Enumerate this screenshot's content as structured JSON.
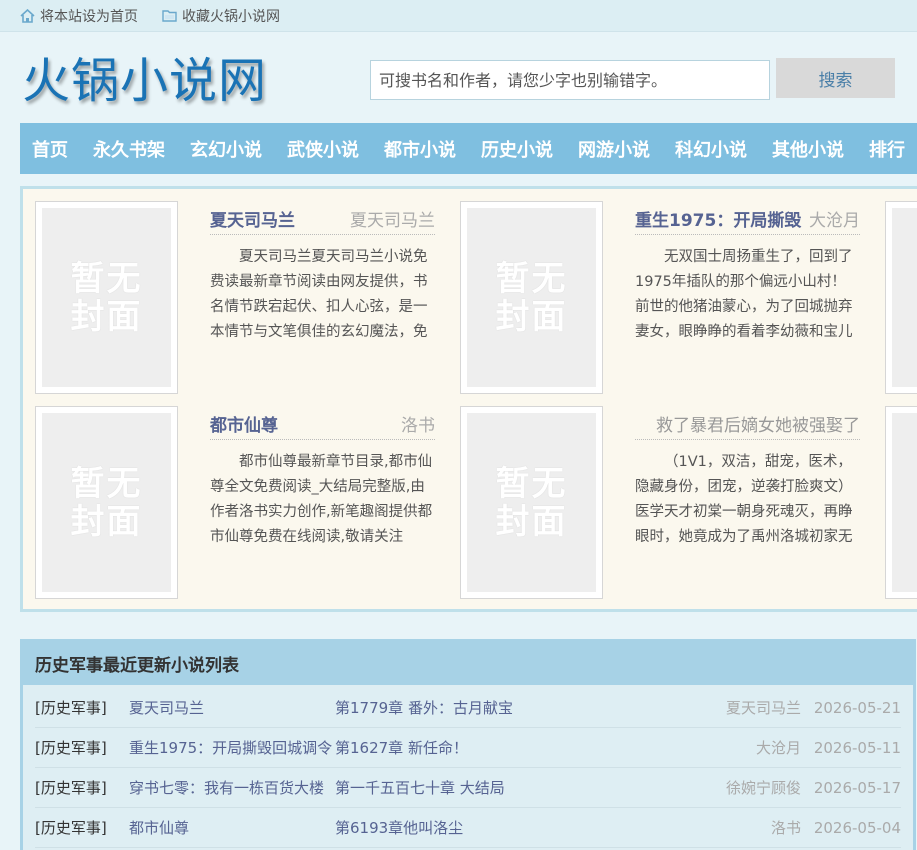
{
  "topbar": {
    "set_home": "将本站设为首页",
    "bookmark": "收藏火锅小说网"
  },
  "header": {
    "logo": "火锅小说网",
    "search_placeholder": "可搜书名和作者，请您少字也别输错字。",
    "search_button": "搜索"
  },
  "nav": [
    "首页",
    "永久书架",
    "玄幻小说",
    "武侠小说",
    "都市小说",
    "历史小说",
    "网游小说",
    "科幻小说",
    "其他小说",
    "排行"
  ],
  "featured": [
    {
      "title": "夏天司马兰",
      "author": "夏天司马兰",
      "cover_text": "暂无封面",
      "desc": "夏天司马兰夏天司马兰小说免费读最新章节阅读由网友提供，书名情节跌宕起伏、扣人心弦，是一本情节与文笔俱佳的玄幻魔法，免费读"
    },
    {
      "title": "重生1975：开局撕毁",
      "author": "大沧月",
      "cover_text": "暂无封面",
      "desc": "无双国士周扬重生了，回到了1975年插队的那个偏远小山村！前世的他猪油蒙心，为了回城抛弃妻女，眼睁睁的看着李幼薇和宝儿"
    },
    {
      "title": "都市仙尊",
      "author": "洛书",
      "cover_text": "暂无封面",
      "desc": "都市仙尊最新章节目录,都市仙尊全文免费阅读_大结局完整版,由作者洛书实力创作,新笔趣阁提供都市仙尊免费在线阅读,敬请关注"
    },
    {
      "title": "救了暴君后嫡女她被强娶了",
      "author": "",
      "cover_text": "暂无封面",
      "desc": "（1V1，双洁，甜宠，医术，隐藏身份，团宠，逆袭打脸爽文）医学天才初棠一朝身死魂灭，再睁眼时，她竟成为了禹州洛城初家无"
    }
  ],
  "list": {
    "heading": "历史军事最近更新小说列表",
    "rows": [
      {
        "category": "[历史军事]",
        "title": "夏天司马兰",
        "chapter": "第1779章 番外：古月献宝",
        "author": "夏天司马兰",
        "date": "2026-05-21"
      },
      {
        "category": "[历史军事]",
        "title": "重生1975：开局撕毁回城调令",
        "chapter": "第1627章 新任命！",
        "author": "大沧月",
        "date": "2026-05-11"
      },
      {
        "category": "[历史军事]",
        "title": "穿书七零：我有一栋百货大楼",
        "chapter": "第一千五百七十章 大结局",
        "author": "徐婉宁顾俊",
        "date": "2026-05-17"
      },
      {
        "category": "[历史军事]",
        "title": "都市仙尊",
        "chapter": "第6193章他叫洛尘",
        "author": "洛书",
        "date": "2026-05-04"
      }
    ]
  }
}
